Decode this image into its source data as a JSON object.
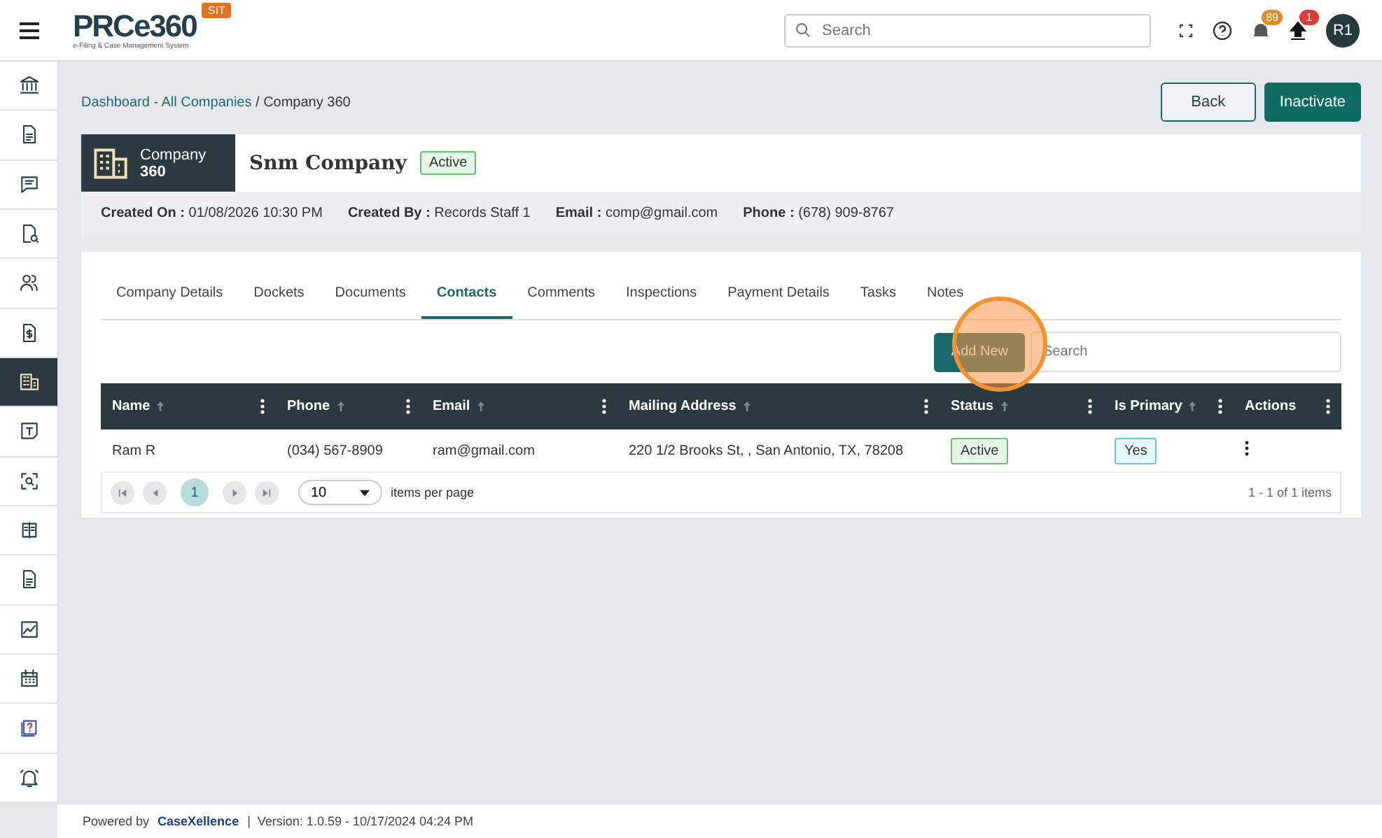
{
  "header": {
    "logo": "PRCe360",
    "tagline": "e-Filing & Case Management System",
    "env_badge": "SIT",
    "search": {
      "placeholder": "Search"
    },
    "notification_count": "89",
    "upload_count": "1",
    "avatar": "R1"
  },
  "sidebar": {
    "items": [
      {
        "selected": false
      },
      {
        "selected": false
      },
      {
        "selected": false
      },
      {
        "selected": false
      },
      {
        "selected": false
      },
      {
        "selected": false
      },
      {
        "selected": true
      },
      {
        "selected": false
      },
      {
        "selected": false
      },
      {
        "selected": false
      },
      {
        "selected": false
      },
      {
        "selected": false
      },
      {
        "selected": false
      },
      {
        "selected": false
      },
      {
        "selected": false
      }
    ]
  },
  "breadcrumb": {
    "link": "Dashboard - All Companies",
    "current": " / Company 360"
  },
  "actions": [
    {
      "label": "Back",
      "kind": "outline"
    },
    {
      "label": "Inactivate",
      "kind": "primary"
    }
  ],
  "company": {
    "badge_label": "Company",
    "badge_number": "360",
    "name": "Snm Company",
    "status": "Active"
  },
  "meta": [
    {
      "label": "Created On :",
      "value": "01/08/2026 10:30 PM"
    },
    {
      "label": "Created By :",
      "value": "Records Staff 1"
    },
    {
      "label": "Email :",
      "value": "comp@gmail.com"
    },
    {
      "label": "Phone :",
      "value": "(678) 909-8767"
    }
  ],
  "tabs": [
    {
      "label": "Company Details",
      "selected": false
    },
    {
      "label": "Dockets",
      "selected": false
    },
    {
      "label": "Documents",
      "selected": false
    },
    {
      "label": "Contacts",
      "selected": true
    },
    {
      "label": "Comments",
      "selected": false
    },
    {
      "label": "Inspections",
      "selected": false
    },
    {
      "label": "Payment Details",
      "selected": false
    },
    {
      "label": "Tasks",
      "selected": false
    },
    {
      "label": "Notes",
      "selected": false
    }
  ],
  "toolbar": {
    "add_button": "Add New",
    "search": {
      "placeholder": "Search"
    }
  },
  "table": {
    "columns": [
      {
        "label": "Name",
        "sortable": true
      },
      {
        "label": "Phone",
        "sortable": true
      },
      {
        "label": "Email",
        "sortable": true
      },
      {
        "label": "Mailing Address",
        "sortable": true
      },
      {
        "label": "Status",
        "sortable": true
      },
      {
        "label": "Is Primary",
        "sortable": true
      },
      {
        "label": "Actions",
        "sortable": false
      }
    ],
    "rows": [
      {
        "name": "Ram R",
        "phone": "(034) 567-8909",
        "email": "ram@gmail.com",
        "address": "220 1/2 Brooks St, , San Antonio, TX, 78208",
        "status": "Active",
        "is_primary": "Yes"
      }
    ]
  },
  "pager": {
    "current_page": "1",
    "page_size": "10",
    "page_size_label": "items per page",
    "summary": "1 - 1 of 1 items"
  },
  "footer": {
    "powered_by": "Powered by",
    "brand": "CaseXellence",
    "version": "|  Version: 1.0.59 - 10/17/2024 04:24 PM"
  }
}
